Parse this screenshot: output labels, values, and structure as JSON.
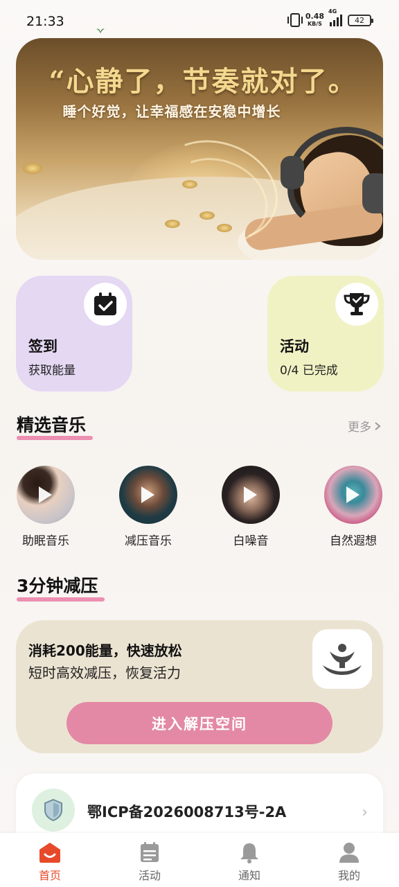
{
  "status_bar": {
    "time": "21:33",
    "net_speed_value": "0.48",
    "net_speed_unit": "KB/S",
    "network_type": "4G",
    "battery": "42"
  },
  "hero": {
    "title": "“心静了，节奏就对了。",
    "subtitle": "睡个好觉，让幸福感在安稳中增长"
  },
  "cards": {
    "signin": {
      "title": "签到",
      "subtitle": "获取能量",
      "icon": "calendar-check-icon",
      "color": "#e4d8f3"
    },
    "activity": {
      "title": "活动",
      "subtitle": "0/4 已完成",
      "icon": "trophy-icon",
      "color": "#f1f2c4"
    }
  },
  "music_section": {
    "title": "精选音乐",
    "more_label": "更多",
    "items": [
      {
        "label": "助眠音乐",
        "icon": "play-icon"
      },
      {
        "label": "减压音乐",
        "icon": "play-icon"
      },
      {
        "label": "白噪音",
        "icon": "play-icon"
      },
      {
        "label": "自然遐想",
        "icon": "play-icon"
      }
    ]
  },
  "relax_section": {
    "title": "3分钟减压",
    "panel_title": "消耗200能量，快速放松",
    "panel_subtitle": "短时高效减压，恢复活力",
    "button_label": "进入解压空间",
    "accent_color": "#e389a5"
  },
  "icp": {
    "text": "鄂ICP备2026008713号-2A",
    "icon": "shield-icon"
  },
  "bottom_nav": {
    "active_color": "#e74a2a",
    "items": [
      {
        "label": "首页",
        "icon": "home-icon",
        "active": true
      },
      {
        "label": "活动",
        "icon": "calendar-icon",
        "active": false
      },
      {
        "label": "通知",
        "icon": "bell-icon",
        "active": false
      },
      {
        "label": "我的",
        "icon": "user-icon",
        "active": false
      }
    ]
  }
}
